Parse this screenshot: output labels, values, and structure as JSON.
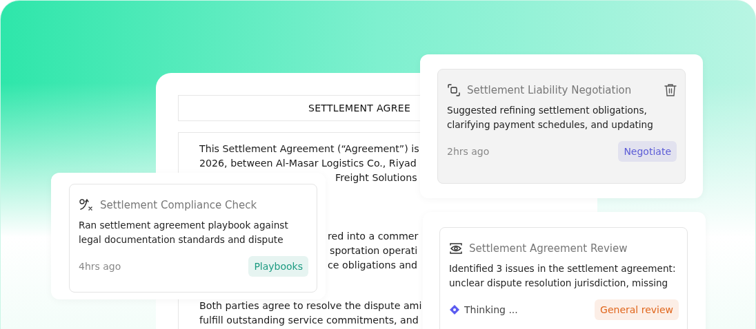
{
  "document": {
    "title": "SETTLEMENT AGREE",
    "paragraphs": [
      {
        "lines": [
          "This Settlement Agreement (“Agreement”) is",
          "2026, between Al-Masar Logistics Co., Riyad",
          "Freight Solutions"
        ]
      },
      {
        "lines": [
          "red into a commer",
          "sportation operati",
          "ce obligations and"
        ]
      },
      {
        "lines": [
          "Both parties agree to resolve the dispute ami",
          "fulfill outstanding service commitments, and"
        ]
      }
    ]
  },
  "cards": [
    {
      "title": "Settlement Compliance Check",
      "body": "Ran settlement agreement playbook against legal documentation standards and dispute",
      "time": "4hrs ago",
      "selected": false,
      "deletable": false,
      "badge": {
        "label": "Playbooks",
        "color": "#1a9a80"
      }
    },
    {
      "title": "Settlement Liability Negotiation",
      "body": "Suggested refining settlement obligations, clarifying payment schedules, and updating",
      "time": "2hrs ago",
      "selected": true,
      "deletable": true,
      "badge": {
        "label": "Negotiate",
        "color": "#5b5bd6"
      }
    },
    {
      "title": "Settlement Agreement Review",
      "body": "Identified 3 issues in the settlement agreement: unclear dispute resolution jurisdiction, missing",
      "status": "Thinking ...",
      "selected": false,
      "deletable": false,
      "badge": {
        "label": "General review",
        "color": "#e0661c"
      }
    }
  ]
}
